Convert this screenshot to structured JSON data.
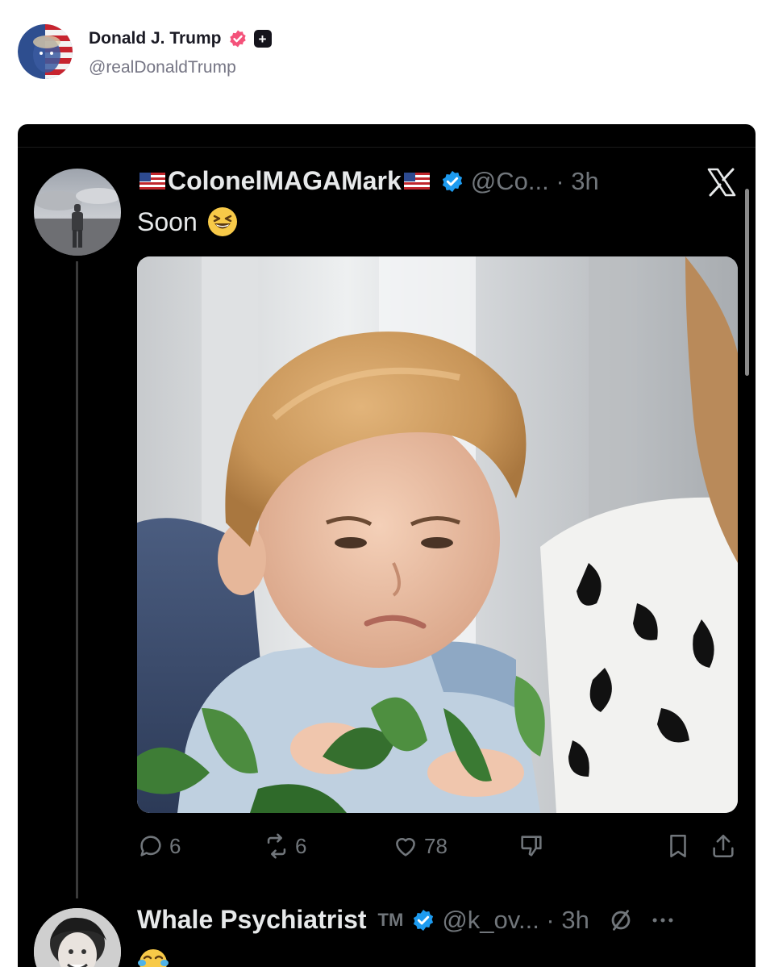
{
  "outer": {
    "name": "Donald J. Trump",
    "handle": "@realDonaldTrump",
    "plus_badge": "+",
    "icons": [
      "verified-pink-icon",
      "plus-icon"
    ]
  },
  "embed": {
    "platform": "X",
    "post1": {
      "name": "ColonelMAGAMark",
      "handle_time": "@Co... · 3h",
      "text": "Soon",
      "emoji": "grinning-squinting-face",
      "actions": {
        "replies": "6",
        "reposts": "6",
        "likes": "78"
      }
    },
    "post2": {
      "name": "Whale Psychiatrist",
      "tm": "TM",
      "handle_time": "@k_ov... · 3h",
      "emoji": "tears-of-joy-face"
    }
  },
  "colors": {
    "x_background": "#000000",
    "x_text": "#e7e9ea",
    "x_muted": "#71767b",
    "x_verified": "#1d9bf0",
    "truth_verified": "#f4527a"
  }
}
